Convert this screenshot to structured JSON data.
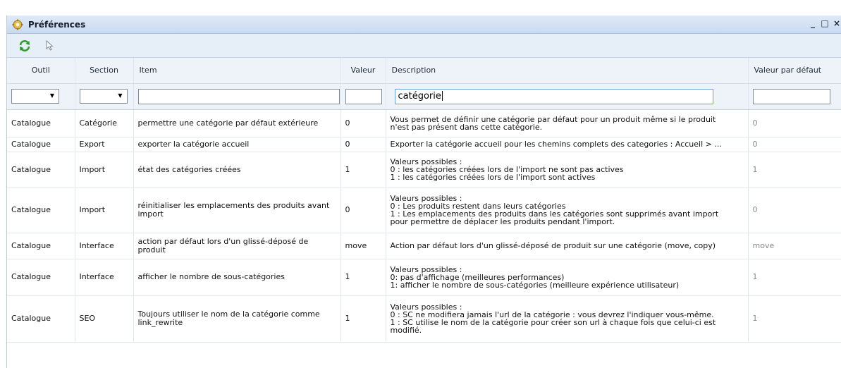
{
  "window": {
    "title": "Préférences",
    "controls": [
      "_",
      "□",
      "×"
    ]
  },
  "toolbar": {
    "icons": [
      "refresh-icon",
      "pointer-icon"
    ]
  },
  "columns": [
    "Outil",
    "Section",
    "Item",
    "Valeur",
    "Description",
    "Valeur par défaut"
  ],
  "filters": {
    "outil": "",
    "section": "",
    "item": "",
    "valeur": "",
    "description": "catégorie",
    "valeur_par_defaut": ""
  },
  "rows": [
    {
      "outil": "Catalogue",
      "section": "Catégorie",
      "item": "permettre une catégorie par défaut extérieure",
      "valeur": "0",
      "description": "Vous permet de définir une catégorie par défaut pour un produit même si le produit\nn'est pas présent dans cette catégorie.",
      "defaut": "0"
    },
    {
      "outil": "Catalogue",
      "section": "Export",
      "item": "exporter la catégorie accueil",
      "valeur": "0",
      "description": "Exporter la catégorie accueil pour les chemins complets des categories : Accueil > ...",
      "defaut": "0"
    },
    {
      "outil": "Catalogue",
      "section": "Import",
      "item": "état des catégories créées",
      "valeur": "1",
      "description": "Valeurs possibles :\n0 : les catégories créées lors de l'import ne sont pas actives\n1 : les catégories créées lors de l'import sont actives",
      "defaut": "1"
    },
    {
      "outil": "Catalogue",
      "section": "Import",
      "item": "réinitialiser les emplacements des produits avant import",
      "valeur": "0",
      "description": "Valeurs possibles :\n0 : Les produits restent dans leurs catégories\n1 : Les emplacements des produits dans les catégories sont supprimés avant import\npour permettre de déplacer les produits pendant l'import.",
      "defaut": "0"
    },
    {
      "outil": "Catalogue",
      "section": "Interface",
      "item": "action par défaut lors d'un glissé-déposé de produit",
      "valeur": "move",
      "description": "Action par défaut lors d'un glissé-déposé de produit sur une catégorie (move, copy)",
      "defaut": "move"
    },
    {
      "outil": "Catalogue",
      "section": "Interface",
      "item": "afficher le nombre de sous-catégories",
      "valeur": "1",
      "description": "Valeurs possibles :\n0: pas d'affichage (meilleures performances)\n1: afficher le nombre de sous-catégories (meilleure expérience utilisateur)",
      "defaut": "1"
    },
    {
      "outil": "Catalogue",
      "section": "SEO",
      "item": "Toujours utiliser le nom de la catégorie comme link_rewrite",
      "valeur": "1",
      "description": "Valeurs possibles :\n0 : SC ne modifiera jamais l'url de la catégorie : vous devrez l'indiquer vous-même.\n1 : SC utilise le nom de la catégorie pour créer son url à chaque fois que celui-ci est\nmodifié.",
      "defaut": "1"
    }
  ]
}
